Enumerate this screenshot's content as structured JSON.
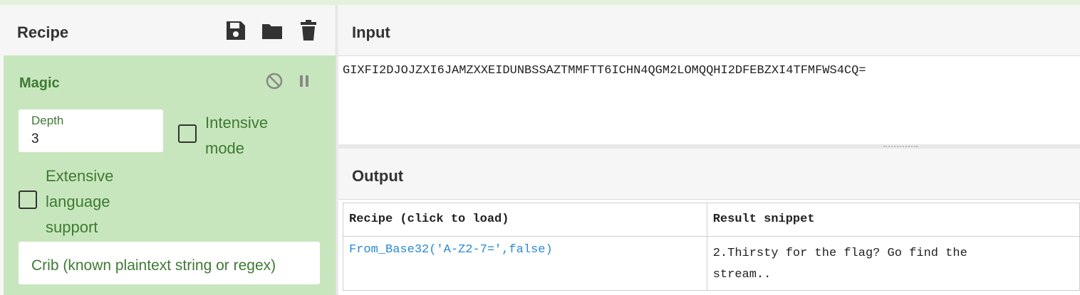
{
  "recipe": {
    "title": "Recipe",
    "icons": [
      "save-icon",
      "folder-icon",
      "trash-icon"
    ],
    "operation": {
      "name": "Magic",
      "icons": [
        "disable-icon",
        "pause-icon"
      ],
      "depth": {
        "label": "Depth",
        "value": "3"
      },
      "intensive": {
        "label_line1": "Intensive",
        "label_line2": "mode",
        "checked": false
      },
      "extensive": {
        "label_line1": "Extensive",
        "label_line2": "language",
        "label_line3": "support",
        "checked": false
      },
      "crib": {
        "placeholder": "Crib (known plaintext string or regex)"
      }
    }
  },
  "input": {
    "title": "Input",
    "text": "GIXFI2DJOJZXI6JAMZXXEIDUNBSSAZTMMFTT6ICHN4QGM2LOMQQHI2DFEBZXI4TFMFWS4CQ="
  },
  "output": {
    "title": "Output",
    "table": {
      "headers": [
        "Recipe (click to load)",
        "Result snippet"
      ],
      "rows": [
        {
          "recipe": "From_Base32('A-Z2-7=',false)",
          "snippet_line1": "2.Thirsty for the flag? Go find the",
          "snippet_line2": "stream.."
        }
      ]
    }
  },
  "colors": {
    "accent_green": "#3d7a33",
    "operation_bg": "#c8e6bd",
    "link": "#2a8ad4"
  }
}
